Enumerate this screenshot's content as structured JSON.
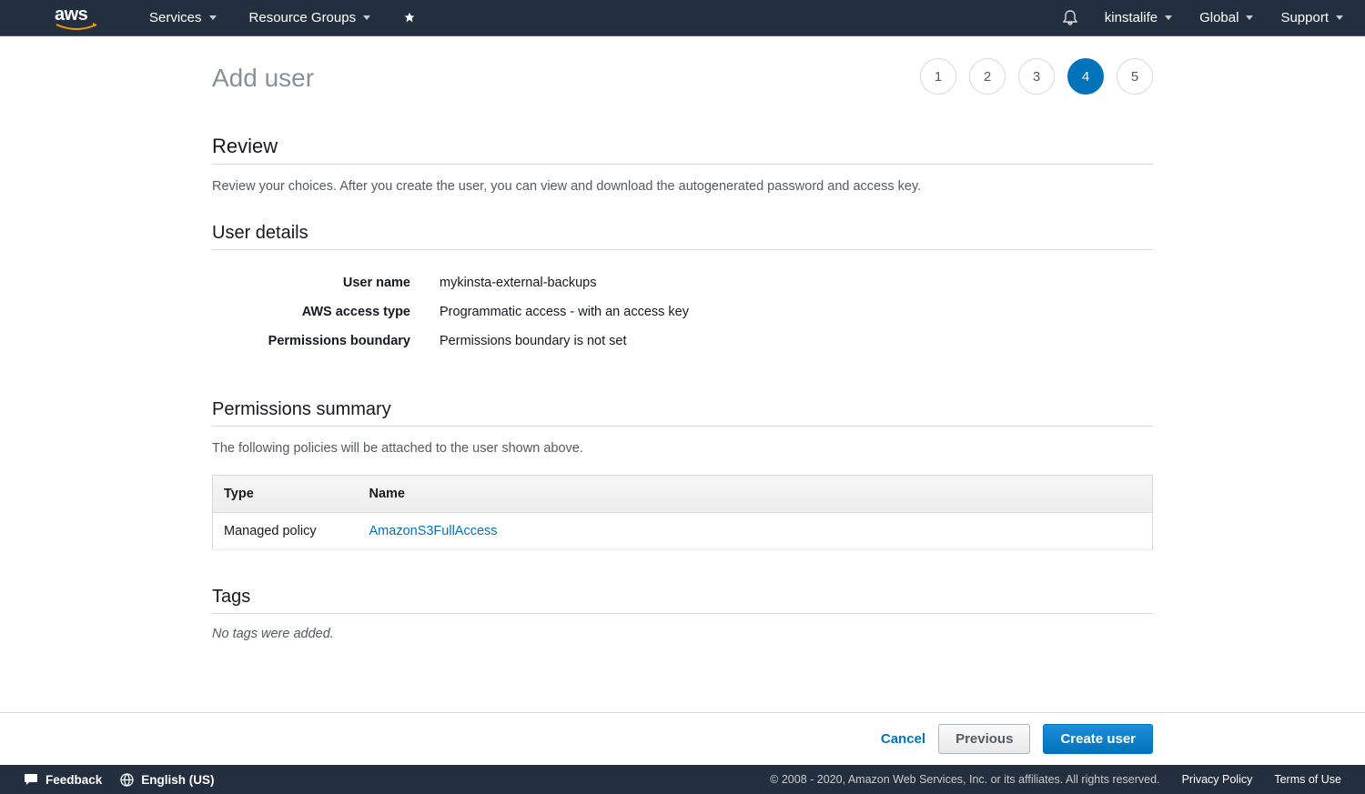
{
  "nav": {
    "services": "Services",
    "resource_groups": "Resource Groups",
    "account": "kinstalife",
    "region": "Global",
    "support": "Support"
  },
  "page": {
    "title": "Add user"
  },
  "steps": [
    "1",
    "2",
    "3",
    "4",
    "5"
  ],
  "active_step": 4,
  "review": {
    "title": "Review",
    "desc": "Review your choices. After you create the user, you can view and download the autogenerated password and access key."
  },
  "user_details": {
    "title": "User details",
    "rows": [
      {
        "label": "User name",
        "value": "mykinsta-external-backups"
      },
      {
        "label": "AWS access type",
        "value": "Programmatic access - with an access key"
      },
      {
        "label": "Permissions boundary",
        "value": "Permissions boundary is not set"
      }
    ]
  },
  "permissions": {
    "title": "Permissions summary",
    "desc": "The following policies will be attached to the user shown above.",
    "cols": {
      "type": "Type",
      "name": "Name"
    },
    "rows": [
      {
        "type": "Managed policy",
        "name": "AmazonS3FullAccess"
      }
    ]
  },
  "tags": {
    "title": "Tags",
    "empty": "No tags were added."
  },
  "actions": {
    "cancel": "Cancel",
    "previous": "Previous",
    "create": "Create user"
  },
  "footer": {
    "feedback": "Feedback",
    "language": "English (US)",
    "copyright": "© 2008 - 2020, Amazon Web Services, Inc. or its affiliates. All rights reserved.",
    "privacy": "Privacy Policy",
    "terms": "Terms of Use"
  }
}
